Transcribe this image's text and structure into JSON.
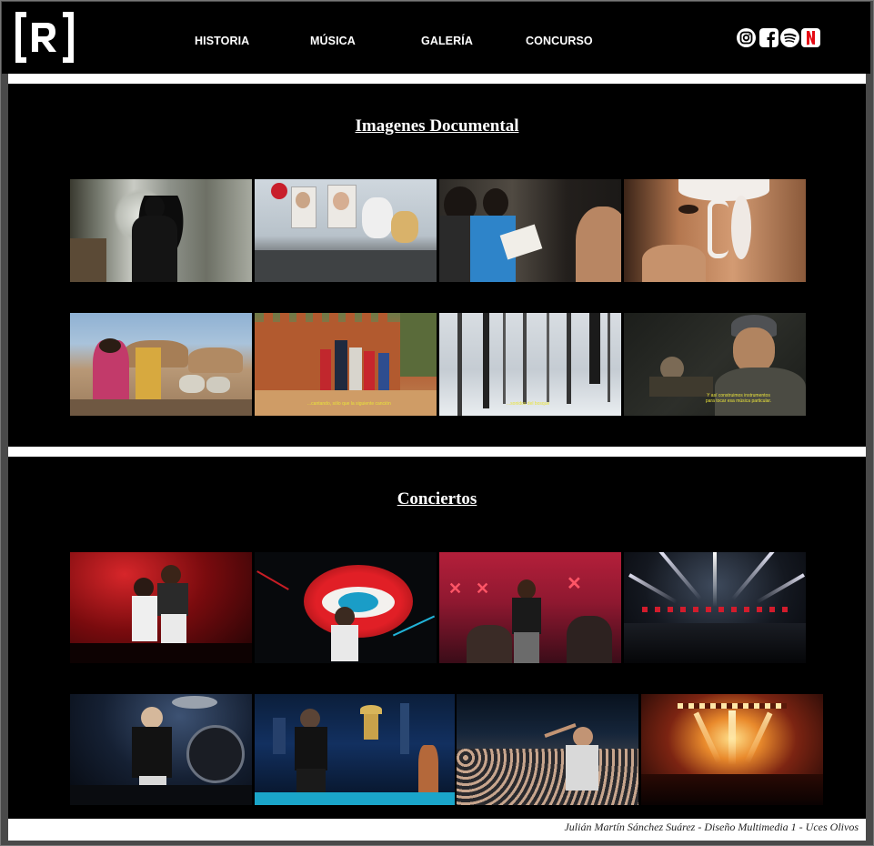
{
  "header": {
    "logo_text": "[R]",
    "nav": [
      "HISTORIA",
      "MÚSICA",
      "GALERÍA",
      "CONCURSO"
    ],
    "social_icons": [
      "instagram-icon",
      "facebook-icon",
      "spotify-icon",
      "netflix-icon"
    ],
    "colors": {
      "background": "#000000",
      "text": "#ffffff",
      "netflix": "#e50914"
    }
  },
  "documental": {
    "title": "Imagenes Documental",
    "photos": [
      "hallway-silhouette-photo",
      "memorial-portraits-photo",
      "students-reading-photo",
      "face-paint-closeup-photo",
      "village-women-photo",
      "desert-musicians-photo",
      "snowy-forest-photo",
      "instrument-maker-photo"
    ],
    "subtitles": {
      "desert": "...cantando, sólo que la siguiente canción",
      "forest": "...sonidos del bosque",
      "maker": "Y así construimos instrumentos para tocar esa música particular."
    }
  },
  "conciertos": {
    "title": "Conciertos",
    "photos": [
      "red-stage-duo-photo",
      "lips-screen-performer-photo",
      "x-stage-band-photo",
      "light-beams-crowd-photo",
      "drummer-stage-photo",
      "city-backdrop-stage-photo",
      "crowd-selfie-photo",
      "golden-stage-lights-photo"
    ]
  },
  "footer": {
    "credit": "Julián Martín Sánchez Suárez - Diseño Multimedia 1 - Uces Olivos"
  }
}
